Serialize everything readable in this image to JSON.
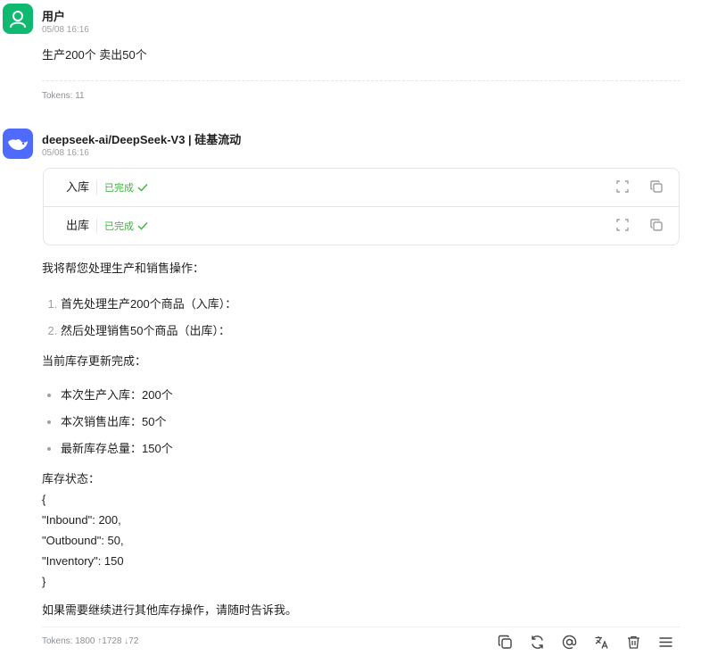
{
  "user_message": {
    "avatar_icon": "user-icon",
    "avatar_color": "#10b970",
    "name": "用户",
    "time": "05/08 16:16",
    "text": "生产200个 卖出50个",
    "tokens": "Tokens: 11"
  },
  "ai_message": {
    "avatar_icon": "whale-logo-icon",
    "avatar_color": "#4f6bfe",
    "name": "deepseek-ai/DeepSeek-V3 | 硅基流动",
    "time": "05/08 16:16",
    "tool_calls": [
      {
        "name": "入库",
        "status": "已完成"
      },
      {
        "name": "出库",
        "status": "已完成"
      }
    ],
    "intro": "我将帮您处理生产和销售操作：",
    "steps": [
      "首先处理生产200个商品（入库）：",
      "然后处理销售50个商品（出库）："
    ],
    "update_heading": "当前库存更新完成：",
    "bullets": [
      "本次生产入库：200个",
      "本次销售出库：50个",
      "最新库存总量：150个"
    ],
    "status_heading": "库存状态：",
    "json_lines": [
      "{",
      "\"Inbound\": 200,",
      "\"Outbound\": 50,",
      "\"Inventory\": 150",
      "}"
    ],
    "closing": "如果需要继续进行其他库存操作，请随时告诉我。",
    "tokens": "Tokens: 1800 ↑1728 ↓72"
  },
  "status_color": "#3cb43c",
  "actions": [
    "copy-icon",
    "regenerate-icon",
    "mention-icon",
    "translate-icon",
    "delete-icon",
    "menu-icon"
  ]
}
